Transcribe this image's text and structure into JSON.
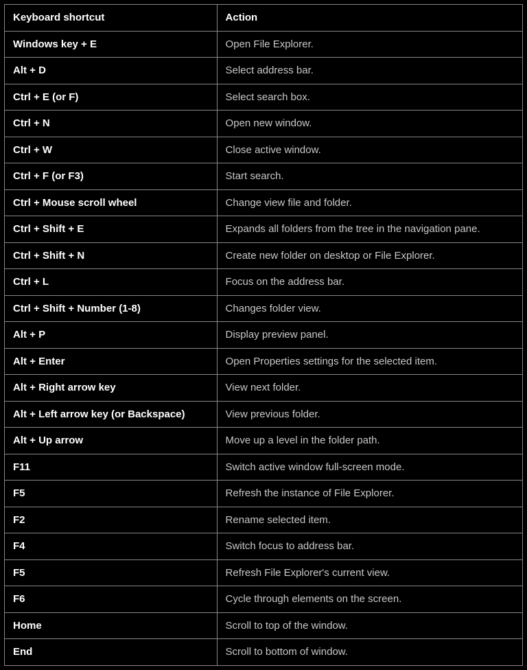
{
  "table": {
    "headers": {
      "shortcut": "Keyboard shortcut",
      "action": "Action"
    },
    "rows": [
      {
        "shortcut": "Windows key + E",
        "action": "Open File Explorer."
      },
      {
        "shortcut": "Alt + D",
        "action": "Select address bar."
      },
      {
        "shortcut": "Ctrl + E (or F)",
        "action": "Select search box."
      },
      {
        "shortcut": "Ctrl + N",
        "action": "Open new window."
      },
      {
        "shortcut": "Ctrl + W",
        "action": "Close active window."
      },
      {
        "shortcut": "Ctrl + F (or F3)",
        "action": "Start search."
      },
      {
        "shortcut": "Ctrl + Mouse scroll wheel",
        "action": "Change view file and folder."
      },
      {
        "shortcut": "Ctrl + Shift + E",
        "action": "Expands all folders from the tree in the navigation pane."
      },
      {
        "shortcut": "Ctrl + Shift + N",
        "action": "Create new folder on desktop or File Explorer."
      },
      {
        "shortcut": "Ctrl + L",
        "action": "Focus on the address bar."
      },
      {
        "shortcut": "Ctrl + Shift + Number (1-8)",
        "action": "Changes folder view."
      },
      {
        "shortcut": "Alt + P",
        "action": "Display preview panel."
      },
      {
        "shortcut": "Alt + Enter",
        "action": "Open Properties settings for the selected item."
      },
      {
        "shortcut": "Alt + Right arrow key",
        "action": "View next folder."
      },
      {
        "shortcut": "Alt + Left arrow key (or Backspace)",
        "action": "View previous folder."
      },
      {
        "shortcut": "Alt + Up arrow",
        "action": "Move up a level in the folder path."
      },
      {
        "shortcut": "F11",
        "action": "Switch active window full-screen mode."
      },
      {
        "shortcut": "F5",
        "action": "Refresh the instance of File Explorer."
      },
      {
        "shortcut": "F2",
        "action": "Rename selected item."
      },
      {
        "shortcut": "F4",
        "action": "Switch focus to address bar."
      },
      {
        "shortcut": "F5",
        "action": "Refresh File Explorer's current view."
      },
      {
        "shortcut": "F6",
        "action": "Cycle through elements on the screen."
      },
      {
        "shortcut": "Home",
        "action": "Scroll to top of the window."
      },
      {
        "shortcut": "End",
        "action": "Scroll to bottom of window."
      }
    ]
  }
}
